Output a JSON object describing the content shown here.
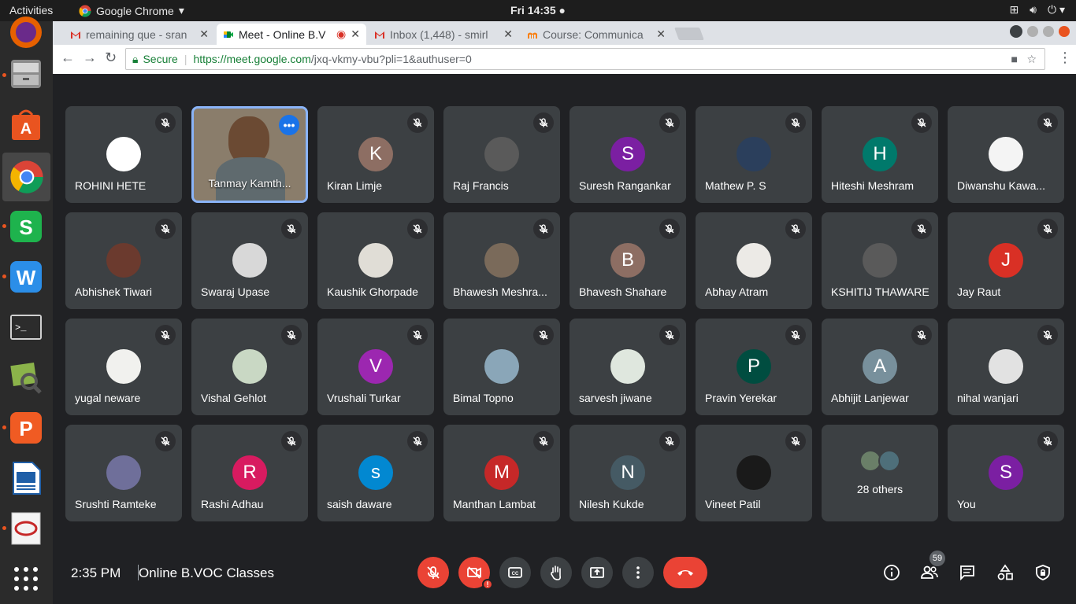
{
  "topbar": {
    "activities": "Activities",
    "app_name": "Google Chrome",
    "clock": "Fri 14:35"
  },
  "dock": {
    "items": [
      {
        "icon": "firefox-icon"
      },
      {
        "icon": "files-icon"
      },
      {
        "icon": "software-center-icon"
      },
      {
        "icon": "chrome-icon"
      },
      {
        "icon": "wps-spreadsheet-icon"
      },
      {
        "icon": "wps-writer-icon"
      },
      {
        "icon": "terminal-icon"
      },
      {
        "icon": "image-viewer-icon"
      },
      {
        "icon": "wps-presentation-icon"
      },
      {
        "icon": "libreoffice-writer-icon"
      },
      {
        "icon": "evince-icon"
      },
      {
        "icon": "show-apps-icon"
      }
    ]
  },
  "browser": {
    "tabs": [
      {
        "label": "remaining que - sran",
        "favicon": "gmail-icon",
        "active": false
      },
      {
        "label": "Meet - Online B.V",
        "favicon": "meet-icon",
        "active": true
      },
      {
        "label": "Inbox (1,448) - smirl",
        "favicon": "gmail-icon",
        "active": false
      },
      {
        "label": "Course: Communica",
        "favicon": "moodle-icon",
        "active": false
      }
    ],
    "secure_label": "Secure",
    "url_host": "https://meet.google.com",
    "url_path": "/jxq-vkmy-vbu?pli=1&authuser=0"
  },
  "meeting": {
    "participants": [
      {
        "name": "ROHINI HETE",
        "initial": "",
        "color": "#ffffff",
        "kind": "photo"
      },
      {
        "name": "Tanmay Kamth...",
        "initial": "",
        "color": "",
        "kind": "video"
      },
      {
        "name": "Kiran Limje",
        "initial": "K",
        "color": "#8d6e63",
        "kind": "letter"
      },
      {
        "name": "Raj Francis",
        "initial": "",
        "color": "#5a5a5a",
        "kind": "photo"
      },
      {
        "name": "Suresh Rangankar",
        "initial": "S",
        "color": "#7b1fa2",
        "kind": "letter"
      },
      {
        "name": "Mathew P. S",
        "initial": "",
        "color": "#2b3f5c",
        "kind": "photo"
      },
      {
        "name": "Hiteshi Meshram",
        "initial": "H",
        "color": "#00796b",
        "kind": "letter"
      },
      {
        "name": "Diwanshu Kawa...",
        "initial": "",
        "color": "#f4f4f4",
        "kind": "photo"
      },
      {
        "name": "Abhishek Tiwari",
        "initial": "",
        "color": "#6b3a2e",
        "kind": "photo"
      },
      {
        "name": "Swaraj Upase",
        "initial": "",
        "color": "#d8d8d8",
        "kind": "photo"
      },
      {
        "name": "Kaushik Ghorpade",
        "initial": "",
        "color": "#e0ddd6",
        "kind": "photo"
      },
      {
        "name": "Bhawesh Meshra...",
        "initial": "",
        "color": "#7a6a5a",
        "kind": "photo"
      },
      {
        "name": "Bhavesh Shahare",
        "initial": "B",
        "color": "#8d6e63",
        "kind": "letter"
      },
      {
        "name": "Abhay Atram",
        "initial": "",
        "color": "#eceae6",
        "kind": "photo"
      },
      {
        "name": "KSHITIJ THAWARE",
        "initial": "",
        "color": "#5a5a5a",
        "kind": "photo"
      },
      {
        "name": "Jay Raut",
        "initial": "J",
        "color": "#d93025",
        "kind": "letter"
      },
      {
        "name": "yugal neware",
        "initial": "",
        "color": "#f1f1ee",
        "kind": "photo"
      },
      {
        "name": "Vishal Gehlot",
        "initial": "",
        "color": "#c9d8c4",
        "kind": "photo"
      },
      {
        "name": "Vrushali Turkar",
        "initial": "V",
        "color": "#9c27b0",
        "kind": "letter"
      },
      {
        "name": "Bimal Topno",
        "initial": "",
        "color": "#8aa6b8",
        "kind": "photo"
      },
      {
        "name": "sarvesh jiwane",
        "initial": "",
        "color": "#dfe7de",
        "kind": "photo"
      },
      {
        "name": "Pravin Yerekar",
        "initial": "P",
        "color": "#004d40",
        "kind": "letter"
      },
      {
        "name": "Abhijit Lanjewar",
        "initial": "A",
        "color": "#78909c",
        "kind": "letter"
      },
      {
        "name": "nihal wanjari",
        "initial": "",
        "color": "#e2e2e2",
        "kind": "photo"
      },
      {
        "name": "Srushti Ramteke",
        "initial": "",
        "color": "#6f6f9a",
        "kind": "photo"
      },
      {
        "name": "Rashi Adhau",
        "initial": "R",
        "color": "#d81b60",
        "kind": "letter"
      },
      {
        "name": "saish daware",
        "initial": "s",
        "color": "#0288d1",
        "kind": "letter"
      },
      {
        "name": "Manthan Lambat",
        "initial": "M",
        "color": "#c62828",
        "kind": "letter"
      },
      {
        "name": "Nilesh Kukde",
        "initial": "N",
        "color": "#455a64",
        "kind": "letter"
      },
      {
        "name": "Vineet Patil",
        "initial": "",
        "color": "#1a1a1a",
        "kind": "photo"
      },
      {
        "name": "28 others",
        "initial": "",
        "color": "",
        "kind": "others"
      },
      {
        "name": "You",
        "initial": "S",
        "color": "#7b1fa2",
        "kind": "letter"
      }
    ]
  },
  "bottombar": {
    "time": "2:35 PM",
    "meeting_title": "Online B.VOC Classes",
    "people_count": "59"
  },
  "colors": {
    "meet_bg": "#202124",
    "tile_bg": "#3c4043",
    "danger": "#ea4335",
    "accent": "#8ab4f8"
  }
}
